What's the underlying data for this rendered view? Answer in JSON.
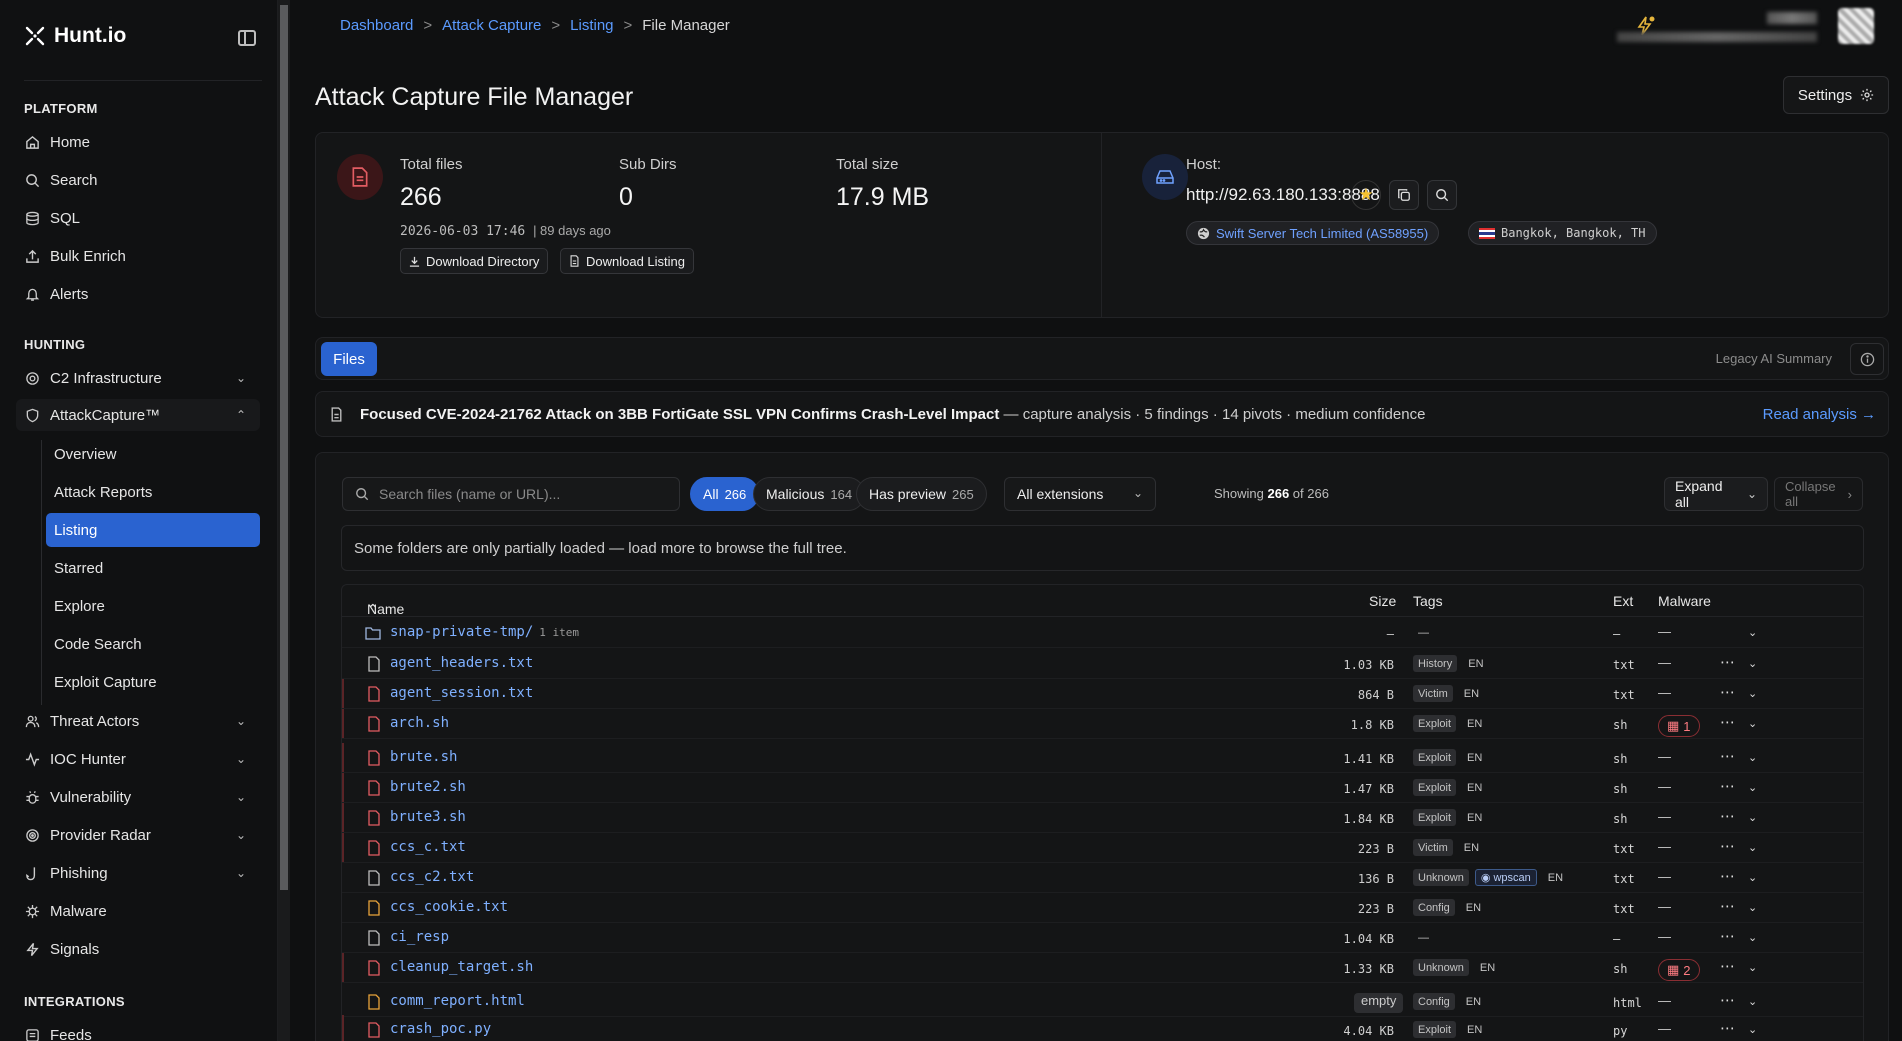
{
  "brand": {
    "name": "Hunt.io"
  },
  "sidebar": {
    "sections": {
      "platform": "PLATFORM",
      "hunting": "HUNTING",
      "integrations": "INTEGRATIONS"
    },
    "platform_items": [
      {
        "label": "Home",
        "icon": "home-icon"
      },
      {
        "label": "Search",
        "icon": "search-icon"
      },
      {
        "label": "SQL",
        "icon": "database-icon"
      },
      {
        "label": "Bulk Enrich",
        "icon": "upload-icon"
      },
      {
        "label": "Alerts",
        "icon": "bell-icon"
      }
    ],
    "hunting_items": [
      {
        "label": "C2 Infrastructure",
        "icon": "target-icon"
      },
      {
        "label": "AttackCapture™",
        "icon": "shield-icon"
      }
    ],
    "attackcapture_sub": [
      "Overview",
      "Attack Reports",
      "Listing",
      "Starred",
      "Explore",
      "Code Search",
      "Exploit Capture"
    ],
    "hunting_items2": [
      {
        "label": "Threat Actors",
        "icon": "users-icon"
      },
      {
        "label": "IOC Hunter",
        "icon": "activity-icon"
      },
      {
        "label": "Vulnerability",
        "icon": "bug-icon"
      },
      {
        "label": "Provider Radar",
        "icon": "radar-icon"
      },
      {
        "label": "Phishing",
        "icon": "hook-icon"
      },
      {
        "label": "Malware",
        "icon": "virus-icon"
      },
      {
        "label": "Signals",
        "icon": "signal-icon"
      }
    ],
    "integrations_items": [
      {
        "label": "Feeds",
        "icon": "feed-icon"
      }
    ]
  },
  "breadcrumb": [
    "Dashboard",
    "Attack Capture",
    "Listing",
    "File Manager"
  ],
  "page": {
    "title": "Attack Capture File Manager",
    "settings": "Settings"
  },
  "stats": {
    "total_files_label": "Total files",
    "total_files": "266",
    "subdirs_label": "Sub Dirs",
    "subdirs": "0",
    "total_size_label": "Total size",
    "total_size": "17.9 MB",
    "date": "2026-06-03 17:46",
    "ago": "| 89 days ago",
    "download_dir": "Download Directory",
    "download_listing": "Download Listing",
    "host_label": "Host:",
    "host": "http://92.63.180.133:8888",
    "asn": "Swift Server Tech Limited (AS58955)",
    "location": "Bangkok, Bangkok, TH"
  },
  "tabs": {
    "files": "Files",
    "legacy": "Legacy AI Summary"
  },
  "analysis": {
    "title": "Focused CVE-2024-21762 Attack on 3BB FortiGate SSL VPN Confirms Crash-Level Impact",
    "meta": " — capture analysis · 5 findings · 14 pivots · medium confidence",
    "read": "Read analysis →"
  },
  "filters": {
    "search_placeholder": "Search files (name or URL)...",
    "all": "All",
    "all_count": "266",
    "malicious": "Malicious",
    "malicious_count": "164",
    "preview": "Has preview",
    "preview_count": "265",
    "extensions": "All extensions",
    "showing_pre": "Showing ",
    "showing_n": "266",
    "showing_post": " of 266",
    "expand": "Expand all",
    "collapse": "Collapse all"
  },
  "notice": "Some folders are only partially loaded — load more to browse the full tree.",
  "table": {
    "headers": {
      "name": "Name",
      "size": "Size",
      "tags": "Tags",
      "ext": "Ext",
      "malware": "Malware"
    },
    "rows": [
      {
        "name": "snap-private-tmp/",
        "extra": "1 item",
        "size": "—",
        "tags": [
          "—"
        ],
        "ext": "—",
        "mal": "—",
        "folder": true
      },
      {
        "name": "agent_headers.txt",
        "size": "1.03 KB",
        "tags": [
          "History",
          "EN"
        ],
        "ext": "txt",
        "mal": "—"
      },
      {
        "name": "agent_session.txt",
        "size": "864 B",
        "tags": [
          "Victim",
          "EN"
        ],
        "ext": "txt",
        "mal": "—",
        "red": true
      },
      {
        "name": "arch.sh",
        "size": "1.8 KB",
        "tags": [
          "Exploit",
          "EN"
        ],
        "ext": "sh",
        "mal": "1",
        "red": true
      },
      {
        "name": "brute.sh",
        "size": "1.41 KB",
        "tags": [
          "Exploit",
          "EN"
        ],
        "ext": "sh",
        "mal": "—",
        "red": true
      },
      {
        "name": "brute2.sh",
        "size": "1.47 KB",
        "tags": [
          "Exploit",
          "EN"
        ],
        "ext": "sh",
        "mal": "—",
        "red": true
      },
      {
        "name": "brute3.sh",
        "size": "1.84 KB",
        "tags": [
          "Exploit",
          "EN"
        ],
        "ext": "sh",
        "mal": "—",
        "red": true
      },
      {
        "name": "ccs_c.txt",
        "size": "223 B",
        "tags": [
          "Victim",
          "EN"
        ],
        "ext": "txt",
        "mal": "—",
        "red": true
      },
      {
        "name": "ccs_c2.txt",
        "size": "136 B",
        "tags": [
          "Unknown",
          "wpscan",
          "EN"
        ],
        "ext": "txt",
        "mal": "—"
      },
      {
        "name": "ccs_cookie.txt",
        "size": "223 B",
        "tags": [
          "Config",
          "EN"
        ],
        "ext": "txt",
        "mal": "—",
        "amber": true
      },
      {
        "name": "ci_resp",
        "size": "1.04 KB",
        "tags": [
          "—"
        ],
        "ext": "—",
        "mal": "—"
      },
      {
        "name": "cleanup_target.sh",
        "size": "1.33 KB",
        "tags": [
          "Unknown",
          "EN"
        ],
        "ext": "sh",
        "mal": "2",
        "red": true
      },
      {
        "name": "comm_report.html",
        "size": "empty",
        "tags": [
          "Config",
          "EN"
        ],
        "ext": "html",
        "mal": "—",
        "amber": true
      },
      {
        "name": "crash_poc.py",
        "size": "4.04 KB",
        "tags": [
          "Exploit",
          "EN"
        ],
        "ext": "py",
        "mal": "—",
        "red": true
      }
    ]
  }
}
